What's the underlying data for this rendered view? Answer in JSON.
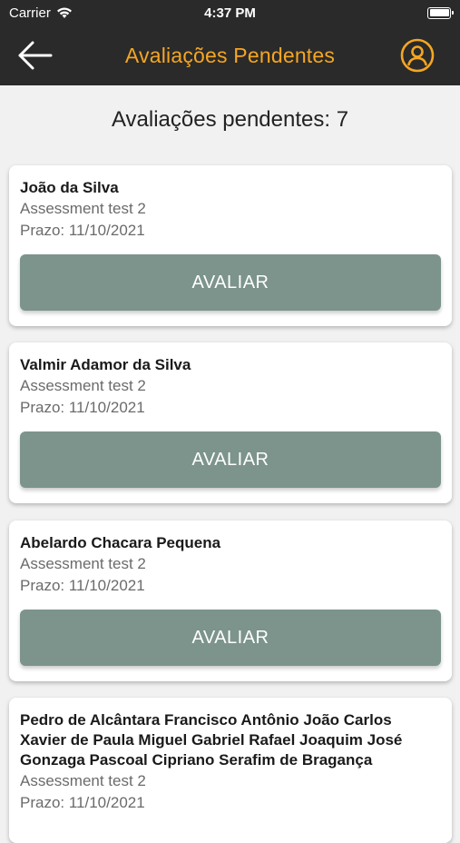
{
  "status_bar": {
    "carrier": "Carrier",
    "time": "4:37 PM"
  },
  "nav": {
    "title": "Avaliações Pendentes"
  },
  "pending_count_text": "Avaliações pendentes: 7",
  "cards": [
    {
      "name": "João da Silva",
      "assessment": "Assessment test 2",
      "deadline": "Prazo: 11/10/2021",
      "button_label": "AVALIAR"
    },
    {
      "name": "Valmir Adamor da Silva",
      "assessment": "Assessment test 2",
      "deadline": "Prazo: 11/10/2021",
      "button_label": "AVALIAR"
    },
    {
      "name": "Abelardo Chacara Pequena",
      "assessment": "Assessment test 2",
      "deadline": "Prazo: 11/10/2021",
      "button_label": "AVALIAR"
    },
    {
      "name_lines": [
        "Pedro de Alcântara Francisco Antônio João Carlos",
        "Xavier de Paula Miguel Gabriel Rafael Joaquim José",
        "Gonzaga Pascoal Cipriano Serafim de Bragança"
      ],
      "assessment": "Assessment test 2",
      "deadline": "Prazo: 11/10/2021"
    }
  ],
  "icons": {
    "back": "arrow-left-icon",
    "profile": "user-circle-icon",
    "wifi": "wifi-icon",
    "battery": "battery-icon"
  },
  "colors": {
    "header_bg": "#2a2a2a",
    "accent": "#f5a623",
    "button_bg": "#7c948c",
    "page_bg": "#f1f1f1"
  }
}
